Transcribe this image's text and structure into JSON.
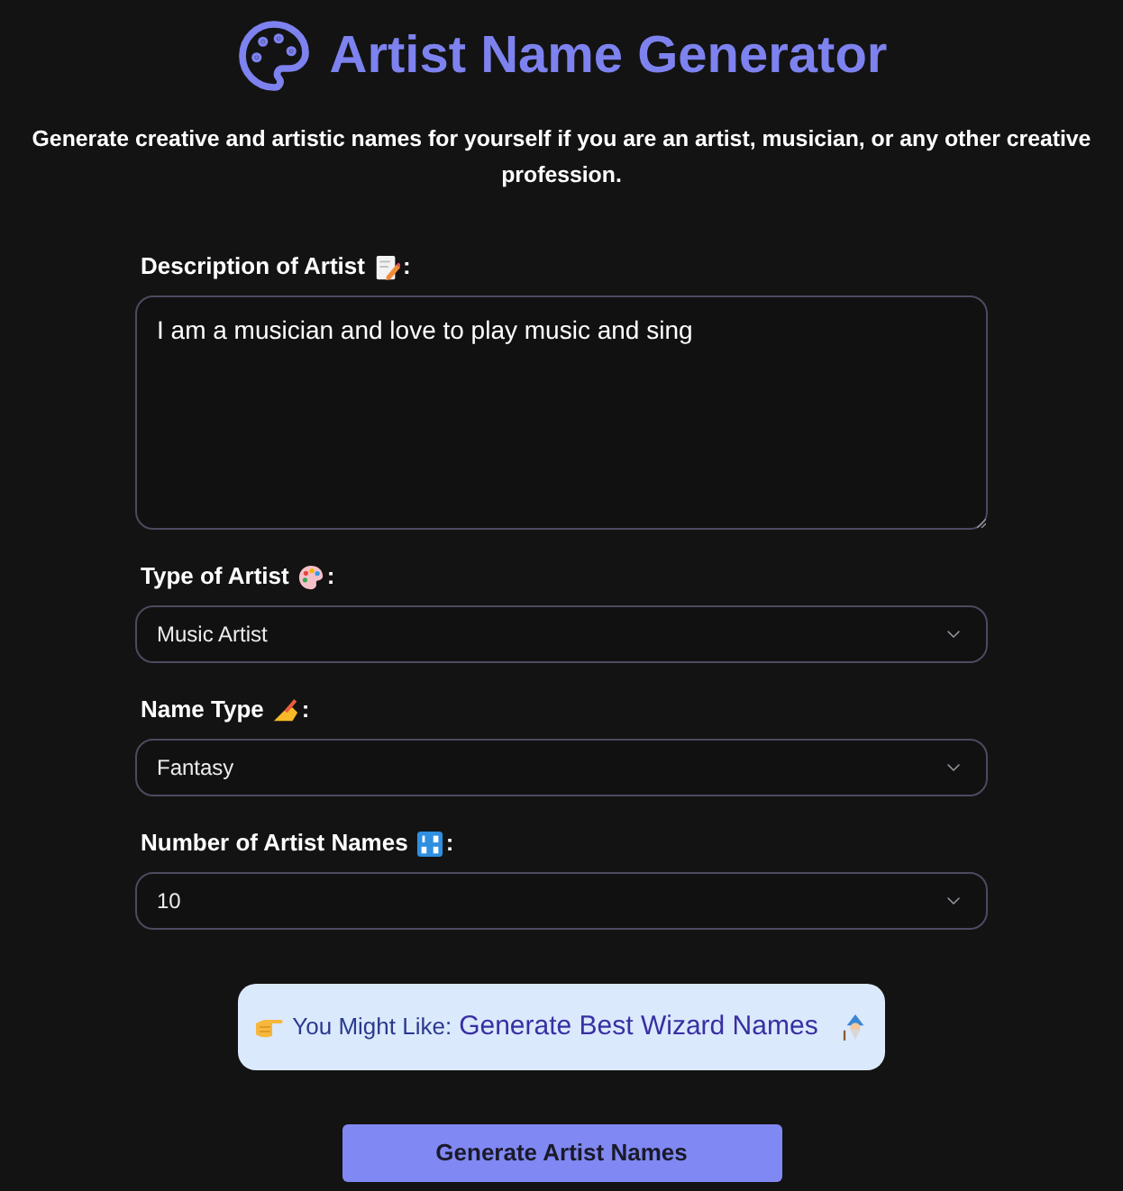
{
  "header": {
    "title": "Artist Name Generator",
    "subtitle": "Generate creative and artistic names for yourself if you are an artist, musician, or any other creative profession."
  },
  "form": {
    "fields": [
      {
        "kind": "textarea",
        "label": "Description of Artist",
        "suffix": ":",
        "value": "I am a musician and love to play music and sing"
      },
      {
        "kind": "select",
        "label": "Type of Artist",
        "suffix": ":",
        "value": "Music Artist"
      },
      {
        "kind": "select",
        "label": "Name Type",
        "suffix": ":",
        "value": "Fantasy"
      },
      {
        "kind": "select",
        "label": "Number of Artist Names",
        "suffix": ":",
        "value": "10"
      }
    ]
  },
  "suggestion": {
    "prefix": "You Might Like:",
    "link": "Generate Best Wizard Names"
  },
  "button": {
    "label": "Generate Artist Names"
  }
}
